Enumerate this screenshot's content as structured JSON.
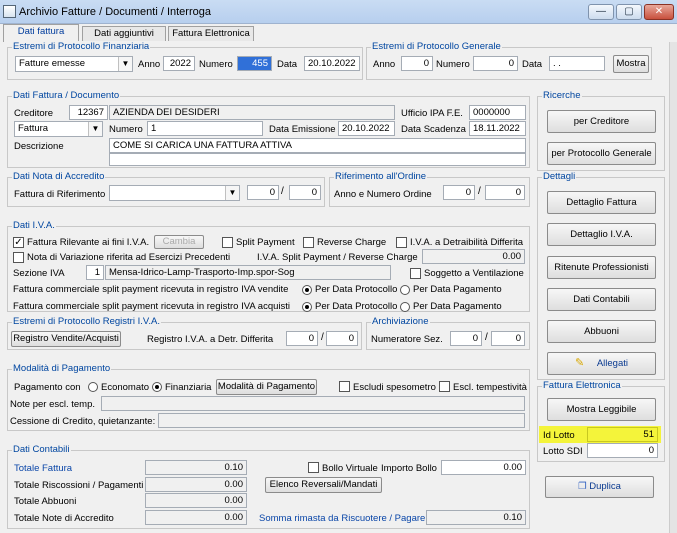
{
  "window": {
    "title": "Archivio Fatture / Documenti / Interroga",
    "btn_min": "—",
    "btn_max": "▢",
    "btn_close": "✕"
  },
  "tabs": [
    {
      "label": "Dati fattura"
    },
    {
      "label": "Dati aggiuntivi"
    },
    {
      "label": "Fattura Elettronica"
    }
  ],
  "prot_fin": {
    "title": "Estremi di Protocollo Finanziaria",
    "tipo": "Fatture emesse",
    "anno_lbl": "Anno",
    "anno": "2022",
    "numero_lbl": "Numero",
    "numero": "455",
    "data_lbl": "Data",
    "data": "20.10.2022"
  },
  "prot_gen": {
    "title": "Estremi di Protocollo Generale",
    "anno_lbl": "Anno",
    "anno": "0",
    "numero_lbl": "Numero",
    "numero": "0",
    "data_lbl": "Data",
    "data": " .  . ",
    "mostra": "Mostra"
  },
  "fattura": {
    "title": "Dati Fattura / Documento",
    "creditore_lbl": "Creditore",
    "creditore_cod": "12367",
    "creditore_nome": "AZIENDA DEI DESIDERI",
    "ufficio_lbl": "Ufficio IPA F.E.",
    "ufficio": "0000000",
    "tipo": "Fattura",
    "numero_lbl": "Numero",
    "numero": "1",
    "emissione_lbl": "Data Emissione",
    "emissione": "20.10.2022",
    "scadenza_lbl": "Data Scadenza",
    "scadenza": "18.11.2022",
    "descrizione_lbl": "Descrizione",
    "descrizione": "COME SI CARICA UNA FATTURA ATTIVA",
    "descrizione2": ""
  },
  "nota": {
    "title": "Dati Nota di Accredito",
    "rif_lbl": "Fattura di Riferimento",
    "val1": "0",
    "val2": "0"
  },
  "ordine": {
    "title": "Riferimento all'Ordine",
    "lbl": "Anno e Numero Ordine",
    "val1": "0",
    "val2": "0"
  },
  "iva": {
    "title": "Dati I.V.A.",
    "rilevante": "Fattura Rilevante ai fini I.V.A.",
    "cambia": "Cambia",
    "split": "Split Payment",
    "reverse": "Reverse Charge",
    "detraibilita": "I.V.A. a Detraibilità Differita",
    "nota_var": "Nota di Variazione riferita ad Esercizi Precedenti",
    "split_rev_lbl": "I.V.A. Split Payment / Reverse Charge",
    "split_rev_val": "0.00",
    "sezione_lbl": "Sezione IVA",
    "sezione_cod": "1",
    "sezione_nome": "Mensa-Idrico-Lamp-Trasporto-Imp.spor-Sog",
    "ventilazione": "Soggetto a Ventilazione",
    "vendite_lbl": "Fattura commerciale split payment ricevuta in registro IVA vendite",
    "acquisti_lbl": "Fattura commerciale split payment ricevuta in registro IVA acquisti",
    "per_prot": "Per Data Protocollo",
    "per_pag": "Per Data Pagamento"
  },
  "registri": {
    "title": "Estremi di Protocollo Registri I.V.A.",
    "btn": "Registro Vendite/Acquisti",
    "detr_lbl": "Registro I.V.A. a Detr. Differita",
    "val1": "0",
    "val2": "0"
  },
  "archiviazione": {
    "title": "Archiviazione",
    "lbl": "Numeratore Sez.",
    "val1": "0",
    "val2": "0"
  },
  "pagamento": {
    "title": "Modalità di Pagamento",
    "lbl": "Pagamento con",
    "economato": "Economato",
    "finanziaria": "Finanziaria",
    "modalita_btn": "Modalità di Pagamento",
    "escludi_spes": "Escludi spesometro",
    "escl_temp": "Escl. tempestività",
    "note_lbl": "Note per escl. temp.",
    "cessione_lbl": "Cessione di Credito, quietanzante:"
  },
  "contabili": {
    "title": "Dati Contabili",
    "totale_fattura_lbl": "Totale Fattura",
    "totale_fattura": "0.10",
    "riscossioni_lbl": "Totale Riscossioni / Pagamenti",
    "riscossioni": "0.00",
    "abbuoni_lbl": "Totale Abbuoni",
    "abbuoni": "0.00",
    "note_acc_lbl": "Totale Note di Accredito",
    "note_acc": "0.00",
    "bollo": "Bollo Virtuale",
    "importo_bollo_lbl": "Importo Bollo",
    "importo_bollo": "0.00",
    "elenco_btn": "Elenco Reversali/Mandati",
    "somma_lbl": "Somma rimasta da Riscuotere / Pagare",
    "somma": "0.10"
  },
  "ricerche": {
    "title": "Ricerche",
    "btn1": "per Creditore",
    "btn2": "per Protocollo Generale"
  },
  "dettagli": {
    "title": "Dettagli",
    "btn1": "Dettaglio Fattura",
    "btn2": "Dettaglio I.V.A.",
    "btn3": "Ritenute Professionisti",
    "btn4": "Dati Contabili",
    "btn5": "Abbuoni",
    "btn6": "Allegati"
  },
  "fe": {
    "title": "Fattura Elettronica",
    "btn": "Mostra Leggibile",
    "idlotto_lbl": "Id Lotto",
    "idlotto": "51",
    "lottosdi_lbl": "Lotto SDI",
    "lottosdi": "0",
    "duplica": "Duplica"
  }
}
